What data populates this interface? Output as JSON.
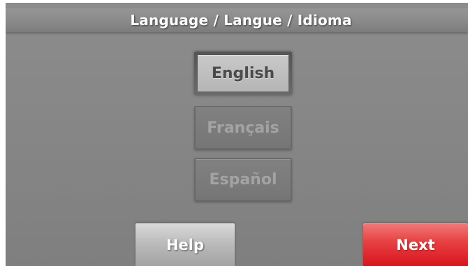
{
  "title": "Language / Langue /  Idioma",
  "languages": [
    {
      "label": "English",
      "selected": true
    },
    {
      "label": "Français",
      "selected": false
    },
    {
      "label": "Español",
      "selected": false
    }
  ],
  "buttons": {
    "help": "Help",
    "next": "Next"
  },
  "colors": {
    "background": "#868686",
    "next_accent": "#e32a2e",
    "help_gray": "#bcbcbc"
  }
}
